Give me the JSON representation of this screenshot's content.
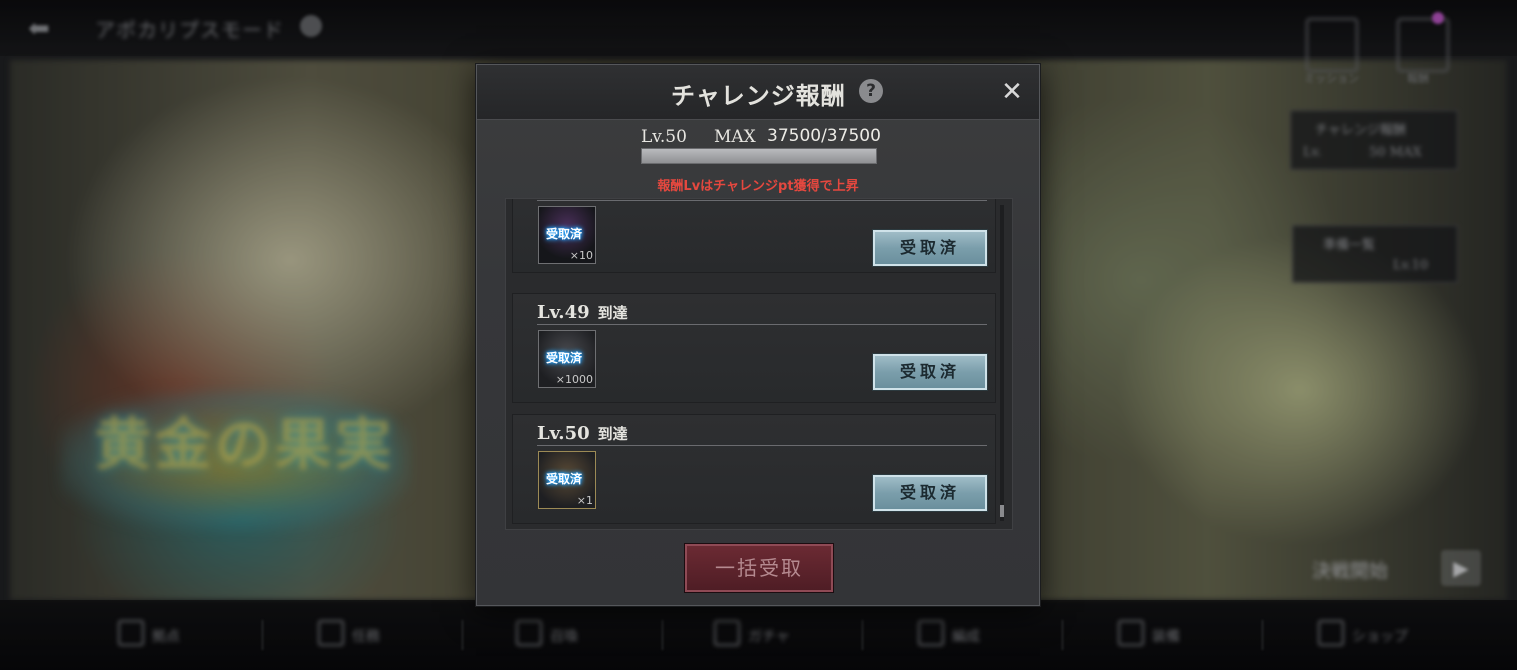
{
  "background": {
    "back_icon": "back-arrow-icon",
    "title": "アポカリプスモード",
    "top_icons": [
      {
        "icon": "mission-icon",
        "label": "ミッション"
      },
      {
        "icon": "menu-icon",
        "label": "報酬"
      }
    ],
    "notification_color": "#c65ad0",
    "side_panels": [
      {
        "title": "チャレンジ報酬",
        "sub_left": "Lv.",
        "sub_right": "50 MAX"
      },
      {
        "title": "準備一覧",
        "sub_left": "",
        "sub_right": "Lv.10"
      }
    ],
    "banner_text": "黄金の果実",
    "start_label": "決戦開始",
    "start_icon": "play-arrow-icon",
    "nav": [
      {
        "icon": "home-icon",
        "label": "拠点"
      },
      {
        "icon": "quest-icon",
        "label": "任務"
      },
      {
        "icon": "summon-icon",
        "label": "召喚"
      },
      {
        "icon": "gacha-icon",
        "label": "ガチャ"
      },
      {
        "icon": "unit-icon",
        "label": "編成"
      },
      {
        "icon": "equip-icon",
        "label": "装備"
      },
      {
        "icon": "shop-icon",
        "label": "ショップ"
      }
    ]
  },
  "modal": {
    "title": "チャレンジ報酬",
    "help_glyph": "?",
    "close_glyph": "✕",
    "level_label": "Lv.50",
    "max_label": "MAX",
    "points": "37500/37500",
    "progress": 1.0,
    "hint": "報酬Lvはチャレンジpt獲得で上昇",
    "rewards": [
      {
        "level": "",
        "goal": "",
        "icon": "orb-icon",
        "stamp": "受取済",
        "qty": "×10",
        "button": "受取済"
      },
      {
        "level": "Lv.49",
        "goal": "到達",
        "icon": "hammer-icon",
        "stamp": "受取済",
        "qty": "×1000",
        "button": "受取済"
      },
      {
        "level": "Lv.50",
        "goal": "到達",
        "icon": "ticket-icon",
        "stamp": "受取済",
        "qty": "×1",
        "button": "受取済"
      }
    ],
    "bulk_button": "一括受取",
    "accent_colors": {
      "hint": "#e5483f",
      "claimed_button": "#7b9eab",
      "bulk_button": "#5a222b"
    }
  }
}
